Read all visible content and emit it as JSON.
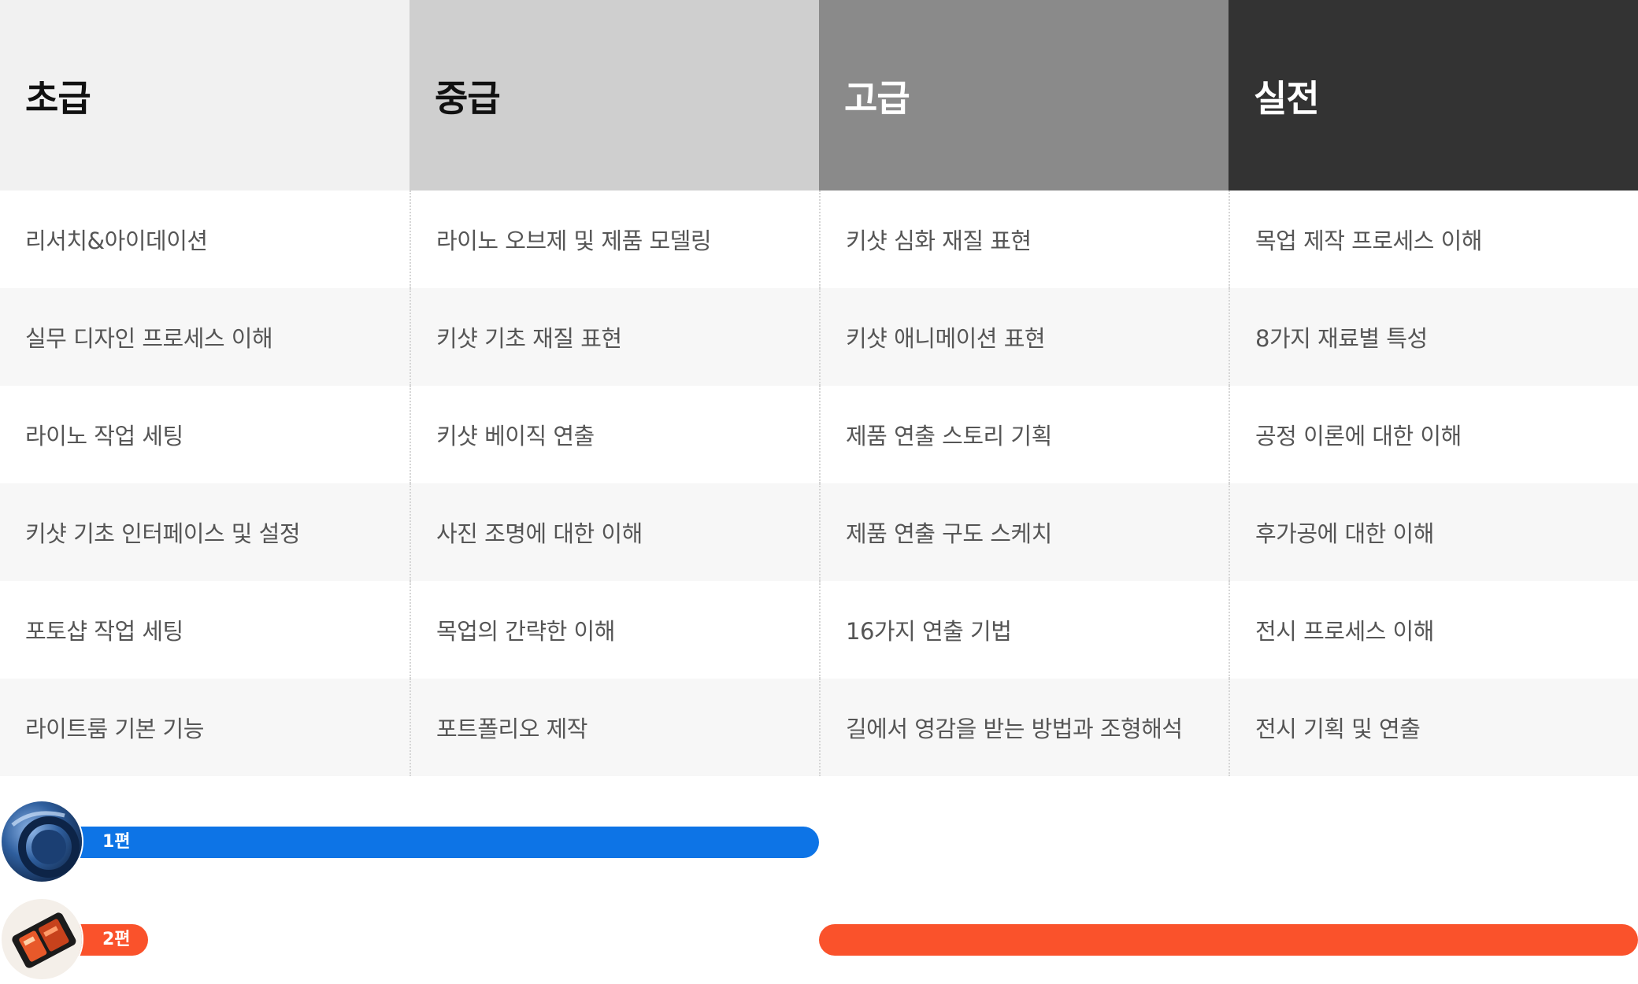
{
  "columns": [
    {
      "title": "초급",
      "items": [
        "리서치&아이데이션",
        "실무 디자인 프로세스 이해",
        "라이노 작업 세팅",
        "키샷 기초 인터페이스 및 설정",
        "포토샵 작업 세팅",
        "라이트룸 기본 기능"
      ]
    },
    {
      "title": "중급",
      "items": [
        "라이노 오브제 및 제품 모델링",
        "키샷 기초 재질 표현",
        "키샷 베이직 연출",
        "사진 조명에 대한 이해",
        "목업의 간략한 이해",
        "포트폴리오 제작"
      ]
    },
    {
      "title": "고급",
      "items": [
        "키샷 심화 재질 표현",
        "키샷 애니메이션 표현",
        "제품 연출 스토리 기획",
        "제품 연출 구도 스케치",
        "16가지 연출 기법",
        "길에서 영감을 받는 방법과 조형해석"
      ]
    },
    {
      "title": "실전",
      "items": [
        "목업 제작 프로세스 이해",
        "8가지 재료별 특성",
        "공정 이론에 대한 이해",
        "후가공에 대한 이해",
        "전시 프로세스 이해",
        "전시 기획 및 연출"
      ]
    }
  ],
  "parts": [
    {
      "label": "1편",
      "color": "#0d74e6",
      "covers": [
        "초급",
        "중급"
      ]
    },
    {
      "label": "2편",
      "color": "#fa522b",
      "covers": [
        "고급",
        "실전"
      ]
    }
  ]
}
